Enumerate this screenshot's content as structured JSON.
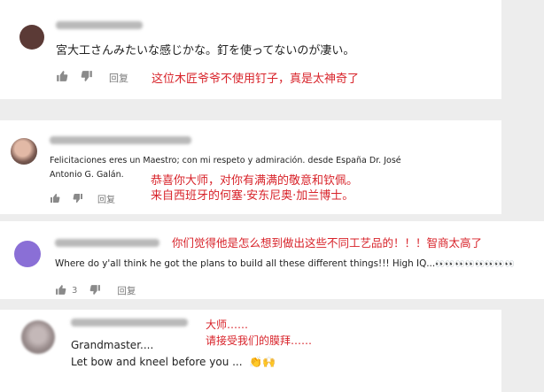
{
  "comments": [
    {
      "text": "宮大工さんみたいな感じかな。釘を使ってないのが凄い。",
      "reply_label": "回复",
      "translation": "这位木匠爷爷不使用钉子，真是太神奇了"
    },
    {
      "text_line1": "Felicitaciones eres un Maestro; con mi respeto y admiración. desde España Dr. José",
      "text_line2": "Antonio G. Galán.",
      "reply_label": "回复",
      "translation_line1": "恭喜你大师，对你有满满的敬意和钦佩。",
      "translation_line2": "来自西班牙的何塞·安东尼奥·加兰博士。"
    },
    {
      "text": "Where do y'all think he got the plans to build all these different things!!! High IQ...",
      "emoji": "👀👀👀👀👀👀👀👀",
      "like_count": "3",
      "reply_label": "回复",
      "translation": "你们觉得他是怎么想到做出这些不同工艺品的！！！智商太高了"
    },
    {
      "text_line1": "Grandmaster....",
      "text_line2": "Let bow and kneel before you ...",
      "emoji": "👏🙌",
      "translation_line1": "大师……",
      "translation_line2": "请接受我们的膜拜……"
    }
  ],
  "colors": {
    "translation_red": "#d8232a",
    "avatar_brown": "#5b3a36",
    "avatar_purple": "#8a6fd6"
  },
  "icons": [
    "thumb-up-icon",
    "thumb-down-icon"
  ]
}
